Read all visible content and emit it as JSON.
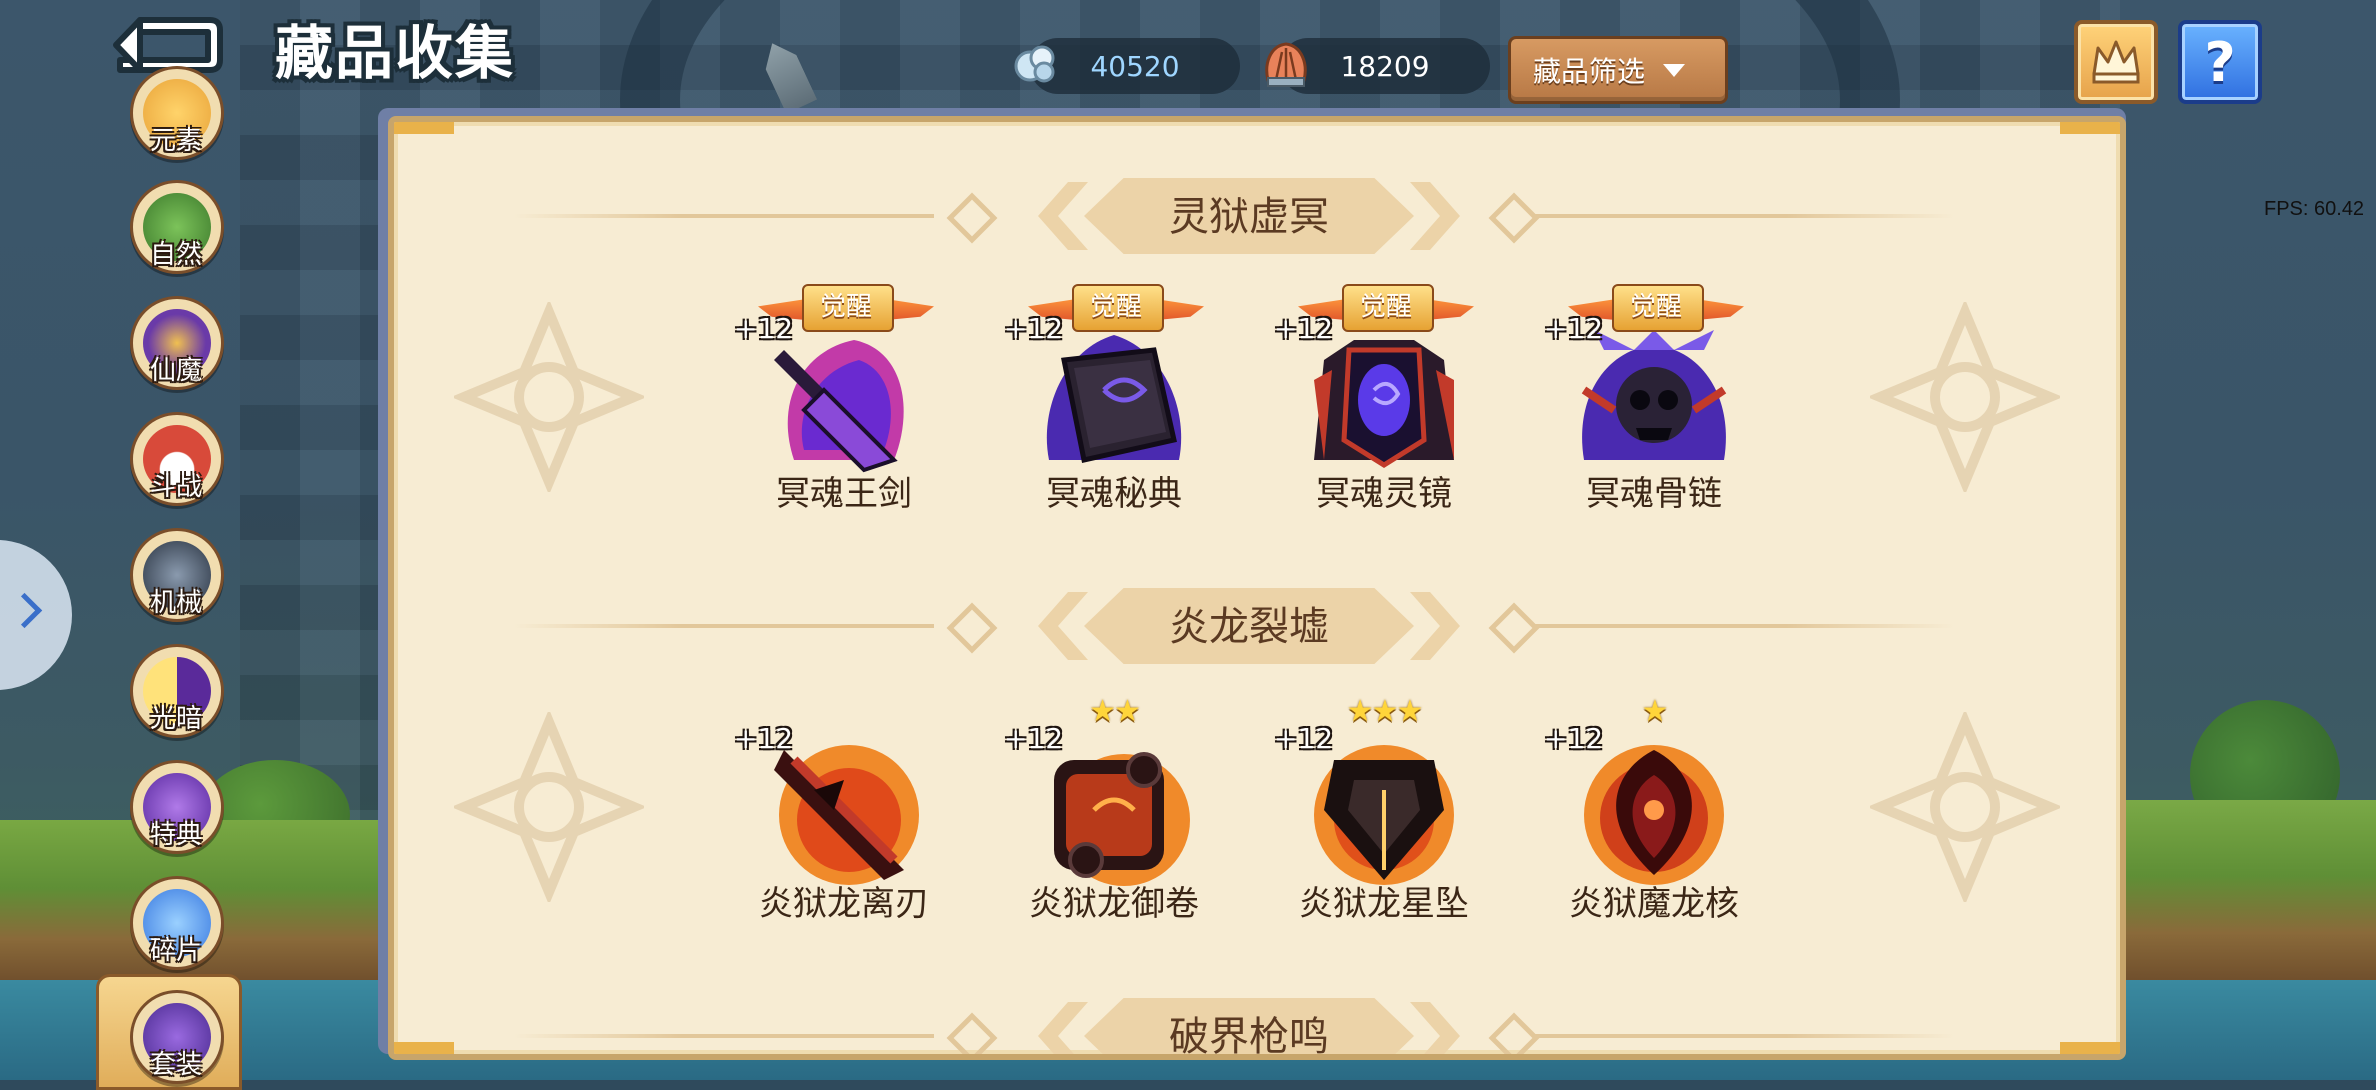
{
  "header": {
    "title": "藏品收集",
    "back_icon": "back-arrow-icon"
  },
  "currencies": [
    {
      "icon": "pearl-icon",
      "value": "40520",
      "color": "#9fd6ff"
    },
    {
      "icon": "shell-icon",
      "value": "18209",
      "color": "#ffffff"
    }
  ],
  "filter": {
    "label": "藏品筛选"
  },
  "buttons": {
    "crown_icon": "crown-icon",
    "help_label": "?"
  },
  "fps": "FPS: 60.42",
  "sidebar": {
    "items": [
      {
        "label": "元素",
        "color": "#e9b44a"
      },
      {
        "label": "自然",
        "color": "#4e9a3a"
      },
      {
        "label": "仙魔",
        "color": "#7a4ab8"
      },
      {
        "label": "斗战",
        "color": "#d84a3a"
      },
      {
        "label": "机械",
        "color": "#3a4656"
      },
      {
        "label": "光暗",
        "color": "#8a4ad0"
      },
      {
        "label": "特典",
        "color": "#6a3ab8"
      },
      {
        "label": "碎片",
        "color": "#4a8ee8"
      },
      {
        "label": "套装",
        "color": "#6a3aa8",
        "selected": true
      }
    ]
  },
  "sections": [
    {
      "title": "灵狱虚冥",
      "items": [
        {
          "name": "冥魂王剑",
          "level": "+12",
          "awaken": "觉醒",
          "stars": ""
        },
        {
          "name": "冥魂秘典",
          "level": "+12",
          "awaken": "觉醒",
          "stars": ""
        },
        {
          "name": "冥魂灵镜",
          "level": "+12",
          "awaken": "觉醒",
          "stars": ""
        },
        {
          "name": "冥魂骨链",
          "level": "+12",
          "awaken": "觉醒",
          "stars": ""
        }
      ]
    },
    {
      "title": "炎龙裂墟",
      "items": [
        {
          "name": "炎狱龙离刃",
          "level": "+12",
          "awaken": "",
          "stars": ""
        },
        {
          "name": "炎狱龙御卷",
          "level": "+12",
          "awaken": "",
          "stars": "★★"
        },
        {
          "name": "炎狱龙星坠",
          "level": "+12",
          "awaken": "",
          "stars": "★★★"
        },
        {
          "name": "炎狱魔龙核",
          "level": "+12",
          "awaken": "",
          "stars": "★"
        }
      ]
    },
    {
      "title": "破界枪鸣"
    }
  ]
}
